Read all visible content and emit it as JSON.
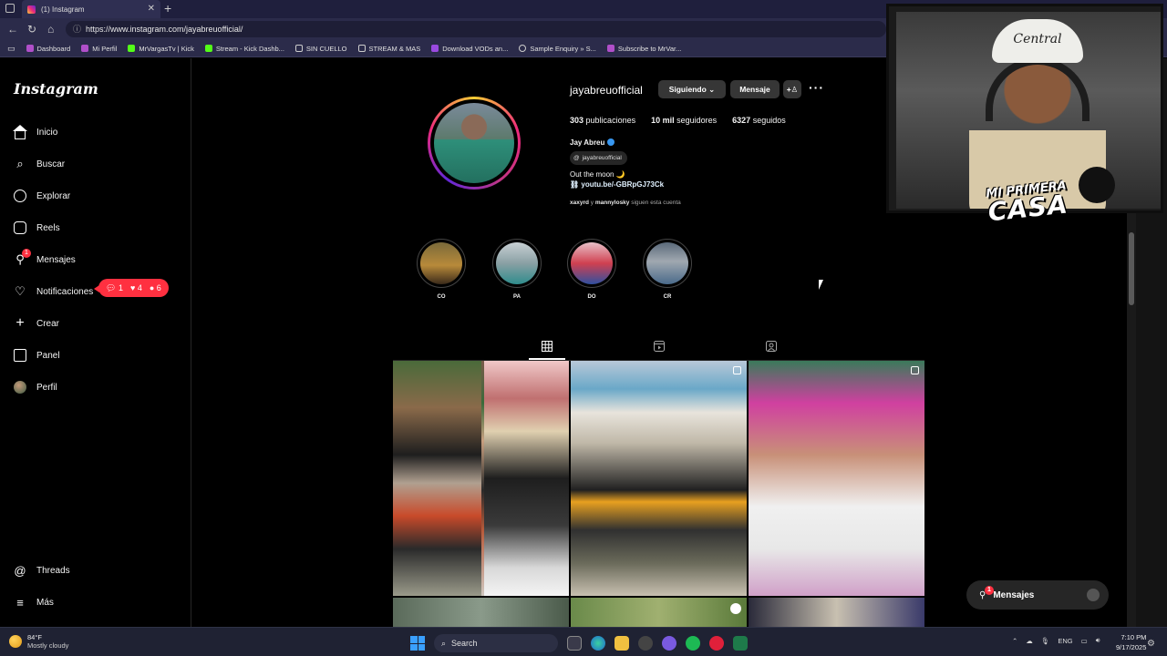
{
  "browser": {
    "tab_title": "(1) Instagram",
    "url": "https://www.instagram.com/jayabreuofficial/",
    "bookmarks": [
      "Dashboard",
      "Mi Perfil",
      "MrVargasTv | Kick",
      "Stream - Kick Dashb...",
      "SIN CUELLO",
      "STREAM & MAS",
      "Download VODs an...",
      "Sample Enquiry » S...",
      "Subscribe to MrVar..."
    ]
  },
  "sidebar": {
    "logo": "Instagram",
    "items": [
      "Inicio",
      "Buscar",
      "Explorar",
      "Reels",
      "Mensajes",
      "Notificaciones",
      "Crear",
      "Panel",
      "Perfil"
    ],
    "bottom": [
      "Threads",
      "Más"
    ],
    "messages_badge": "1",
    "notif_pill": {
      "comments": "1",
      "likes": "4",
      "follows": "6"
    }
  },
  "profile": {
    "username": "jayabreuofficial",
    "following_btn": "Siguiendo",
    "message_btn": "Mensaje",
    "posts_count": "303",
    "posts_label": "publicaciones",
    "followers_count": "10 mil",
    "followers_label": "seguidores",
    "following_count": "6327",
    "following_label": "seguidos",
    "full_name": "Jay Abreu",
    "threads_handle": "jayabreuofficial",
    "bio": "Out the moon 🌙",
    "link": "youtu.be/-GBRpGJ73Ck",
    "followed_by_1": "xaxyrd",
    "followed_by_joiner": "y",
    "followed_by_2": "mannylosky",
    "followed_by_suffix": "siguen esta cuenta"
  },
  "highlights": [
    "CO",
    "PA",
    "DO",
    "CR"
  ],
  "floating_messages": {
    "label": "Mensajes",
    "badge": "1"
  },
  "webcam": {
    "hat_text": "Central",
    "overlay_line1": "MI PRIMERA",
    "overlay_line2": "CASA"
  },
  "taskbar": {
    "temp": "84°F",
    "weather": "Mostly cloudy",
    "search": "Search",
    "lang": "ENG",
    "time": "7:10 PM",
    "date": "9/17/2025"
  },
  "colors": {
    "accent_red": "#ff3040",
    "ig_bg": "#000000",
    "browser_chrome": "#2b2b4a"
  }
}
